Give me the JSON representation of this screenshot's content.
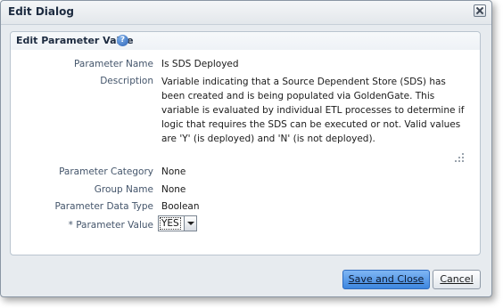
{
  "dialog": {
    "title": "Edit Dialog",
    "panel_title": "Edit Parameter Value",
    "help_icon": "?",
    "fields": {
      "parameter_name_label": "Parameter Name",
      "parameter_name_value": "Is SDS Deployed",
      "description_label": "Description",
      "description_value": "Variable indicating that a Source Dependent Store (SDS) has been created and is being populated via GoldenGate.  This variable is evaluated by individual ETL processes to determine if logic that requires the SDS can be executed or not.  Valid values are 'Y' (is deployed) and 'N' (is not deployed).",
      "parameter_category_label": "Parameter Category",
      "parameter_category_value": "None",
      "group_name_label": "Group Name",
      "group_name_value": "None",
      "parameter_data_type_label": "Parameter Data Type",
      "parameter_data_type_value": "Boolean",
      "parameter_value_label": "* Parameter Value",
      "parameter_value_selected": "YES"
    },
    "buttons": {
      "save_and_close": "Save and Close",
      "cancel": "Cancel"
    }
  },
  "colors": {
    "primary_button": "#3d86df",
    "dialog_background": "#e7ebef"
  }
}
